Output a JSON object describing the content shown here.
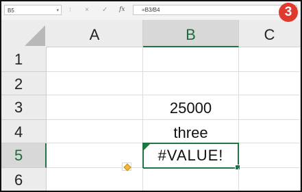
{
  "formula_bar": {
    "name_box": "B5",
    "name_box_dropdown_icon": "chevron-down-icon",
    "separator": "⁝",
    "cancel_icon": "×",
    "enter_icon": "✓",
    "insert_function_label": "fx",
    "formula": "=B3/B4"
  },
  "step_badge": "3",
  "columns": [
    "A",
    "B",
    "C"
  ],
  "selected_column": "B",
  "rows": [
    {
      "header": "1",
      "a": "",
      "b": ""
    },
    {
      "header": "2",
      "a": "",
      "b": ""
    },
    {
      "header": "3",
      "a": "",
      "b": "25000"
    },
    {
      "header": "4",
      "a": "",
      "b": "three"
    },
    {
      "header": "5",
      "a": "",
      "b": "#VALUE!"
    },
    {
      "header": "6",
      "a": "",
      "b": ""
    }
  ],
  "active_cell": "B5",
  "error_icon": "warning-diamond-icon",
  "colors": {
    "accent": "#217346",
    "badge": "#e03a2e"
  }
}
